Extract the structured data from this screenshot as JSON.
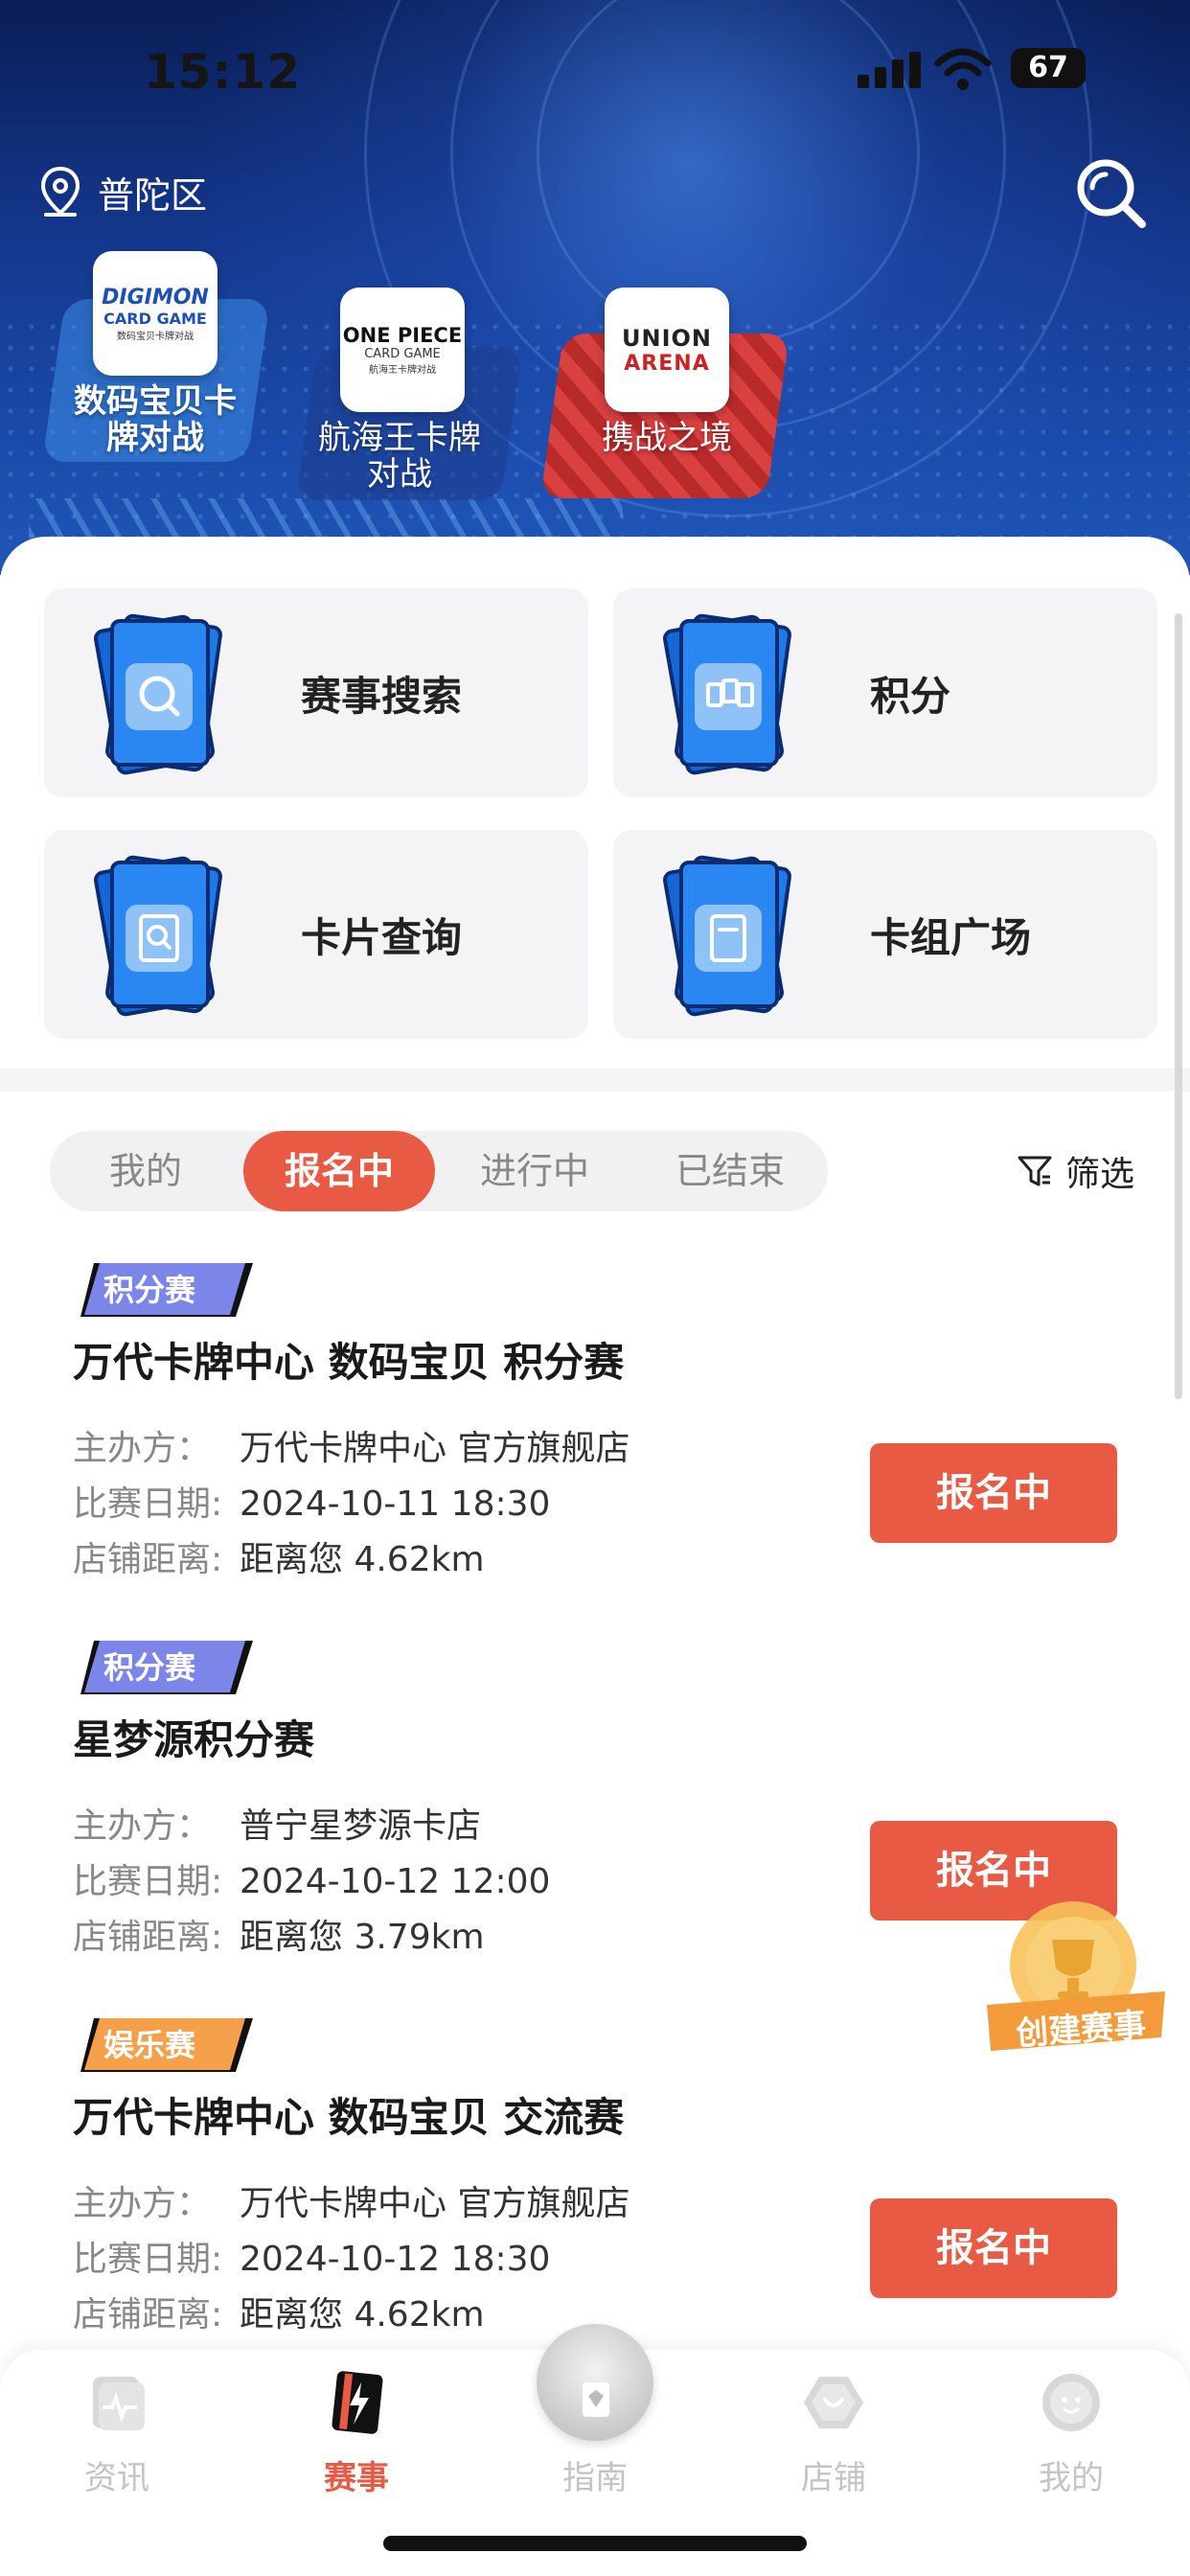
{
  "status_bar": {
    "time": "15:12",
    "battery": "67"
  },
  "header": {
    "location": "普陀区",
    "games": [
      {
        "name": "数码宝贝卡牌对战",
        "logo_text": "DIGIMON",
        "logo_sub": "CARD GAME",
        "logo_cn": "数码宝贝卡牌对战"
      },
      {
        "name": "航海王卡牌对战",
        "logo_text": "ONE PIECE",
        "logo_sub": "CARD GAME",
        "logo_cn": "航海王卡牌对战"
      },
      {
        "name": "携战之境",
        "logo_text": "UNION",
        "logo_sub": "ARENA"
      }
    ]
  },
  "quick_actions": [
    {
      "label": "赛事搜索",
      "icon": "search-icon"
    },
    {
      "label": "积分",
      "icon": "cards-icon"
    },
    {
      "label": "卡片查询",
      "icon": "card-search-icon"
    },
    {
      "label": "卡组广场",
      "icon": "deck-icon"
    }
  ],
  "tabs": [
    {
      "label": "我的",
      "active": false
    },
    {
      "label": "报名中",
      "active": true
    },
    {
      "label": "进行中",
      "active": false
    },
    {
      "label": "已结束",
      "active": false
    }
  ],
  "filter_label": "筛选",
  "field_labels": {
    "organizer": "主办方：",
    "date": "比赛日期:",
    "distance": "店铺距离:"
  },
  "events": [
    {
      "badge": "积分赛",
      "badge_color": "#7b86e8",
      "title": "万代卡牌中心 数码宝贝 积分赛",
      "organizer": "万代卡牌中心 官方旗舰店",
      "date": "2024-10-11 18:30",
      "distance": "距离您 4.62km",
      "button": "报名中"
    },
    {
      "badge": "积分赛",
      "badge_color": "#7b86e8",
      "title": "星梦源积分赛",
      "organizer": "普宁星梦源卡店",
      "date": "2024-10-12 12:00",
      "distance": "距离您 3.79km",
      "button": "报名中"
    },
    {
      "badge": "娱乐赛",
      "badge_color": "#f5a04a",
      "title": "万代卡牌中心 数码宝贝 交流赛",
      "organizer": "万代卡牌中心 官方旗舰店",
      "date": "2024-10-12 18:30",
      "distance": "距离您 4.62km",
      "button": "报名中"
    }
  ],
  "fab_label": "创建赛事",
  "bottom_nav": [
    {
      "label": "资讯",
      "active": false,
      "icon": "news-icon"
    },
    {
      "label": "赛事",
      "active": true,
      "icon": "lightning-card-icon"
    },
    {
      "label": "指南",
      "active": false,
      "icon": "guide-icon"
    },
    {
      "label": "店铺",
      "active": false,
      "icon": "store-icon"
    },
    {
      "label": "我的",
      "active": false,
      "icon": "profile-icon"
    }
  ],
  "colors": {
    "accent": "#e85a43",
    "header_bg": "#153a92",
    "tile_bg": "#f4f4f6"
  }
}
